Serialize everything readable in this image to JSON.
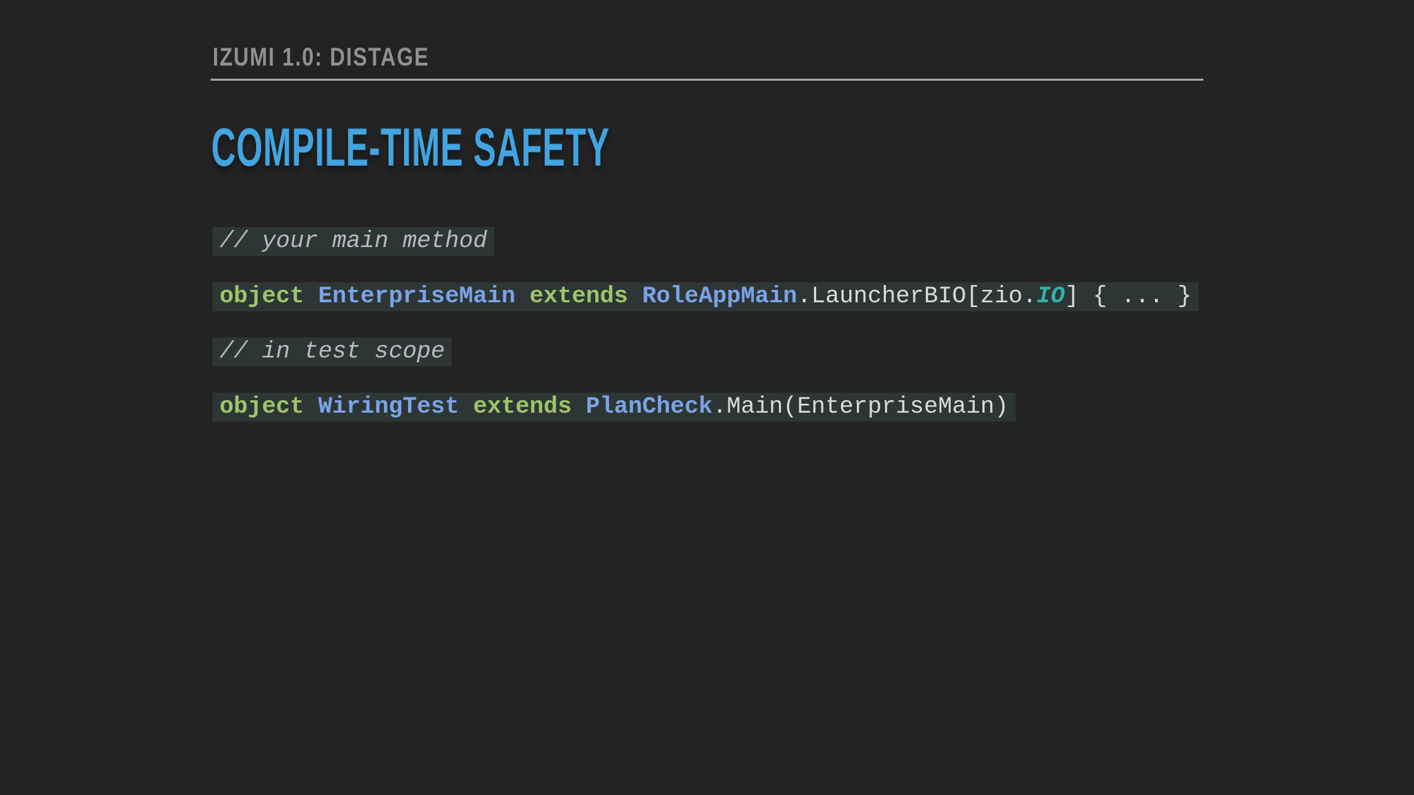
{
  "colors": {
    "background": "#232323",
    "header_text": "#8f9193",
    "divider": "#a6a6a6",
    "title": "#42a4e0",
    "code_background": "#2d3634",
    "comment": "#b6bcbf",
    "plain": "#d9dbdc",
    "keyword": "#9ec46a",
    "type": "#7ba3e8",
    "special": "#30b2a9"
  },
  "header": {
    "label": "IZUMI 1.0: DISTAGE"
  },
  "title": "COMPILE-TIME SAFETY",
  "code": {
    "lines": [
      {
        "tokens": [
          {
            "text": "// your main method",
            "style": "comment"
          }
        ]
      },
      {
        "tokens": [
          {
            "text": "object",
            "style": "keyword"
          },
          {
            "text": " ",
            "style": "plain"
          },
          {
            "text": "EnterpriseMain",
            "style": "type"
          },
          {
            "text": " ",
            "style": "plain"
          },
          {
            "text": "extends",
            "style": "keyword"
          },
          {
            "text": " ",
            "style": "plain"
          },
          {
            "text": "RoleAppMain",
            "style": "type"
          },
          {
            "text": ".LauncherBIO[zio.",
            "style": "plain"
          },
          {
            "text": "IO",
            "style": "special"
          },
          {
            "text": "] { ... }",
            "style": "plain"
          }
        ]
      },
      {
        "tokens": [
          {
            "text": "// in test scope",
            "style": "comment"
          }
        ]
      },
      {
        "tokens": [
          {
            "text": "object",
            "style": "keyword"
          },
          {
            "text": " ",
            "style": "plain"
          },
          {
            "text": "WiringTest",
            "style": "type"
          },
          {
            "text": " ",
            "style": "plain"
          },
          {
            "text": "extends",
            "style": "keyword"
          },
          {
            "text": " ",
            "style": "plain"
          },
          {
            "text": "PlanCheck",
            "style": "type"
          },
          {
            "text": ".Main(EnterpriseMain)",
            "style": "plain"
          }
        ]
      }
    ]
  }
}
